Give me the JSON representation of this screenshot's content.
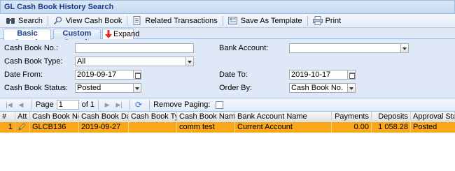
{
  "window": {
    "title": "GL Cash Book History Search"
  },
  "toolbar": {
    "search": "Search",
    "view_cash_book": "View Cash Book",
    "related_transactions": "Related Transactions",
    "save_as_template": "Save As Template",
    "print": "Print"
  },
  "tabs": {
    "basic_search": "Basic Search",
    "custom_search": "Custom Search",
    "expand": "Expand"
  },
  "form": {
    "cash_book_no_label": "Cash Book No.:",
    "cash_book_no_value": "",
    "cash_book_type_label": "Cash Book Type:",
    "cash_book_type_value": "All",
    "date_from_label": "Date From:",
    "date_from_value": "2019-09-17",
    "cash_book_status_label": "Cash Book Status:",
    "cash_book_status_value": "Posted",
    "bank_account_label": "Bank Account:",
    "bank_account_value": "",
    "date_to_label": "Date To:",
    "date_to_value": "2019-10-17",
    "order_by_label": "Order By:",
    "order_by_value": "Cash Book No."
  },
  "pager": {
    "page_label": "Page",
    "page_value": "1",
    "of_label": "of 1",
    "remove_paging_label": "Remove Paging:"
  },
  "grid": {
    "columns": [
      "#",
      "Att",
      "Cash Book No.",
      "Cash Book Date",
      "Cash Book Type",
      "Cash Book Name",
      "Bank Account Name",
      "Payments",
      "Deposits",
      "Approval Status"
    ],
    "rows": [
      {
        "num": "1",
        "cash_book_no": "GLCB136",
        "cash_book_date": "2019-09-27",
        "cash_book_type": "",
        "cash_book_name": "comm test",
        "bank_account_name": "Current Account",
        "payments": "0.00",
        "deposits": "1 058.28",
        "approval_status": "Posted"
      }
    ]
  },
  "colors": {
    "selected_row": "#fba71a",
    "header_text": "#15428b",
    "panel_bg": "#dfe8f6"
  }
}
